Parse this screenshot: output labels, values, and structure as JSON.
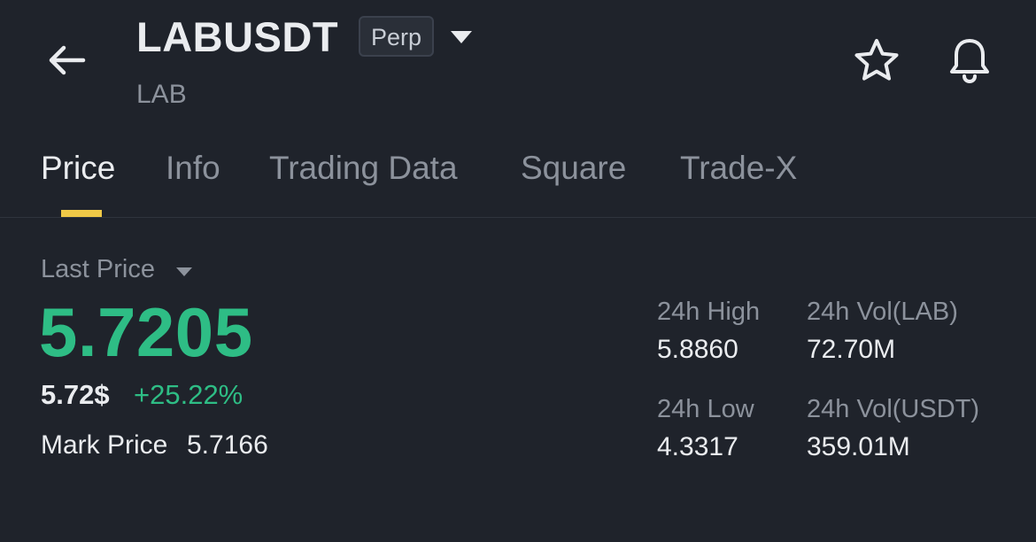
{
  "header": {
    "symbol": "LABUSDT",
    "contract_type": "Perp",
    "base_asset": "LAB"
  },
  "icons": {
    "back": "arrow-left-icon",
    "dropdown": "caret-down-icon",
    "favorite": "star-icon",
    "alert": "bell-icon"
  },
  "tabs": [
    {
      "label": "Price",
      "active": true
    },
    {
      "label": "Info",
      "active": false
    },
    {
      "label": "Trading Data",
      "active": false
    },
    {
      "label": "Square",
      "active": false
    },
    {
      "label": "Trade-X",
      "active": false
    }
  ],
  "price": {
    "last_price_label": "Last Price",
    "last_price": "5.7205",
    "usd_price": "5.72$",
    "change_pct": "+25.22%",
    "mark_price_label": "Mark Price",
    "mark_price": "5.7166"
  },
  "stats": {
    "high_label": "24h High",
    "high_value": "5.8860",
    "low_label": "24h Low",
    "low_value": "4.3317",
    "vol_base_label": "24h Vol(LAB)",
    "vol_base_value": "72.70M",
    "vol_quote_label": "24h Vol(USDT)",
    "vol_quote_value": "359.01M"
  },
  "colors": {
    "background": "#1f232b",
    "positive": "#2ebd85",
    "accent": "#f0c947",
    "text_primary": "#eaecef",
    "text_secondary": "#8c929c"
  }
}
